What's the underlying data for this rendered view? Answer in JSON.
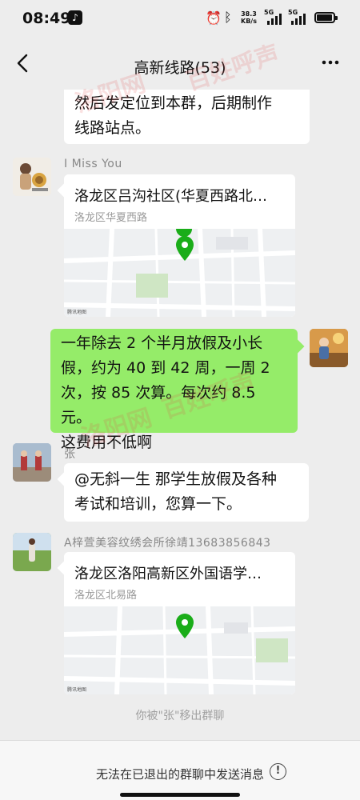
{
  "status_bar": {
    "time": "08:49",
    "speed_value": "38.3",
    "speed_unit": "KB/s",
    "sim1_label": "5G",
    "sim2_label": "5G"
  },
  "nav": {
    "title": "高新线路(53)",
    "back_icon": "chevron-left-icon",
    "more_icon": "more-dots-icon"
  },
  "watermark": {
    "text_a": "洛阳网",
    "text_b": "百姓呼声",
    "color": "#e24646"
  },
  "messages": [
    {
      "type": "text",
      "side": "left",
      "text_lines": [
        "然后发定位到本群，后期制作",
        "线路站点。"
      ]
    },
    {
      "type": "location",
      "side": "left",
      "sender": "I  Miss  You",
      "title": "洛龙区吕沟社区(华夏西路北…",
      "address": "洛龙区华夏西路",
      "map_label": "腾讯地图"
    },
    {
      "type": "text",
      "side": "right",
      "text_lines": [
        "一年除去 2 个半月放假及小长",
        "假，约为 40 到 42 周，一周 2",
        "次，按 85 次算。每次约 8.5 元。",
        "这费用不低啊"
      ]
    },
    {
      "type": "text",
      "side": "left",
      "sender": "张",
      "text_lines": [
        "@无斜一生  那学生放假及各种",
        "考试和培训，您算一下。"
      ]
    },
    {
      "type": "location",
      "side": "left",
      "sender": "A梓萱美容纹绣会所徐靖13683856843",
      "title": "洛龙区洛阳高新区外国语学…",
      "address": "洛龙区北易路",
      "map_label": "腾讯地图"
    }
  ],
  "system_note": "你被\"张\"移出群聊",
  "bottom_bar": {
    "notice": "无法在已退出的群聊中发送消息",
    "info_icon": "info-icon",
    "info_glyph": "!"
  },
  "colors": {
    "background": "#ededed",
    "my_bubble": "#95ec69",
    "other_bubble": "#ffffff",
    "map_pin": "#1aad19"
  }
}
